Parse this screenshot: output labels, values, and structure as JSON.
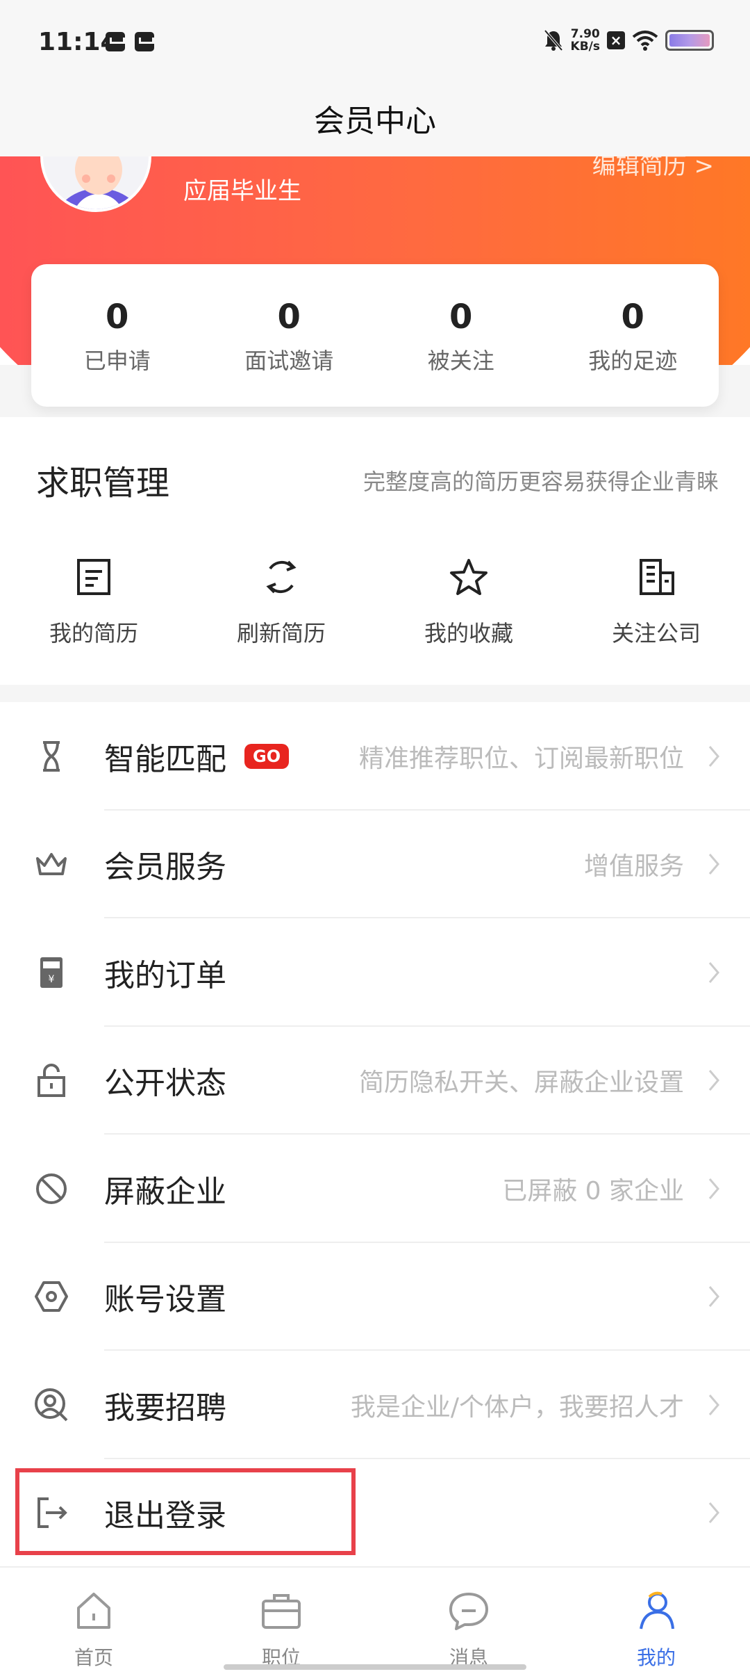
{
  "status_bar": {
    "time": "11:14",
    "speed_value": "7.90",
    "speed_unit": "KB/s"
  },
  "nav": {
    "title": "会员中心"
  },
  "profile": {
    "status": "应届毕业生",
    "edit_resume": "编辑简历 >"
  },
  "stats": [
    {
      "value": "0",
      "label": "已申请"
    },
    {
      "value": "0",
      "label": "面试邀请"
    },
    {
      "value": "0",
      "label": "被关注"
    },
    {
      "value": "0",
      "label": "我的足迹"
    }
  ],
  "job_management": {
    "title": "求职管理",
    "hint": "完整度高的简历更容易获得企业青睐",
    "items": [
      {
        "label": "我的简历",
        "icon": "resume-icon"
      },
      {
        "label": "刷新简历",
        "icon": "refresh-icon"
      },
      {
        "label": "我的收藏",
        "icon": "star-icon"
      },
      {
        "label": "关注公司",
        "icon": "building-icon"
      }
    ]
  },
  "menu": [
    {
      "label": "智能匹配",
      "badge": "GO",
      "desc": "精准推荐职位、订阅最新职位",
      "icon": "hourglass-icon"
    },
    {
      "label": "会员服务",
      "desc": "增值服务",
      "icon": "crown-icon"
    },
    {
      "label": "我的订单",
      "desc": "",
      "icon": "order-icon"
    },
    {
      "label": "公开状态",
      "desc": "简历隐私开关、屏蔽企业设置",
      "icon": "lock-icon"
    },
    {
      "label": "屏蔽企业",
      "desc": "已屏蔽 0 家企业",
      "icon": "block-icon"
    },
    {
      "label": "账号设置",
      "desc": "",
      "icon": "hexagon-settings-icon"
    },
    {
      "label": "我要招聘",
      "desc": "我是企业/个体户，我要招人才",
      "icon": "recruit-icon"
    },
    {
      "label": "退出登录",
      "desc": "",
      "icon": "logout-icon"
    }
  ],
  "tabs": [
    {
      "label": "首页",
      "icon": "home-icon"
    },
    {
      "label": "职位",
      "icon": "briefcase-icon"
    },
    {
      "label": "消息",
      "icon": "chat-icon"
    },
    {
      "label": "我的",
      "icon": "user-icon",
      "active": true
    }
  ],
  "colors": {
    "accent": "#3a6fe6",
    "header_start": "#ff5158",
    "header_end": "#ff7a22",
    "badge": "#e8251f",
    "highlight": "#e8414a"
  }
}
